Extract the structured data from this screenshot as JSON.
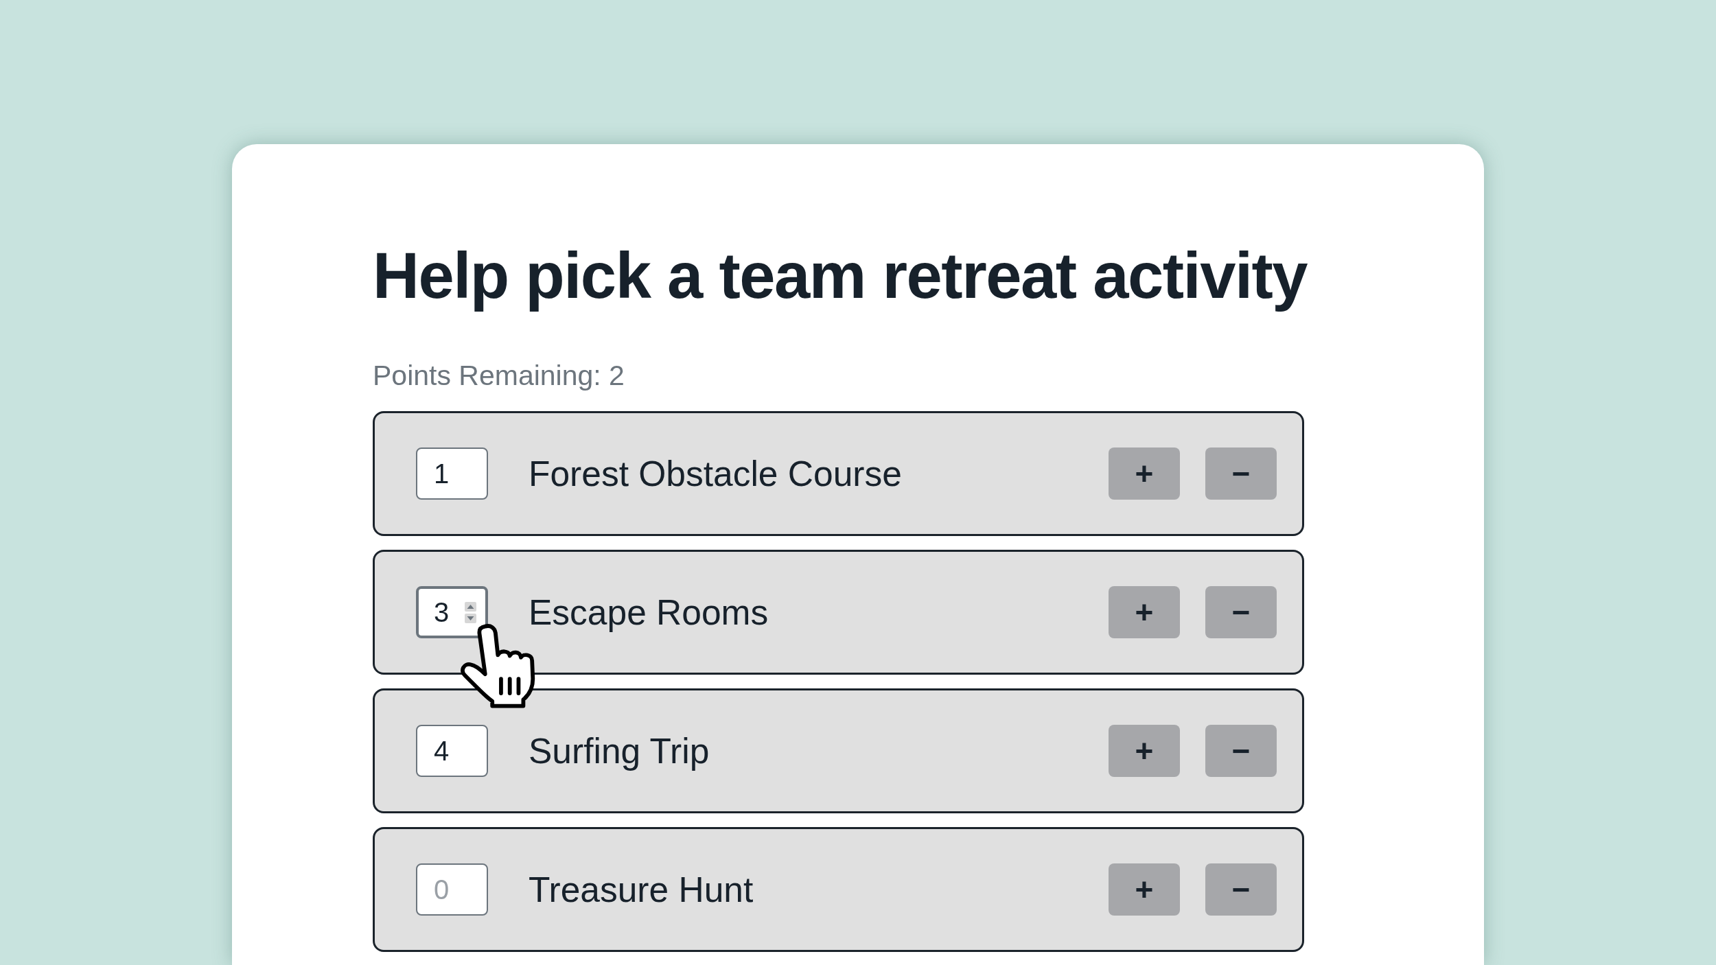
{
  "title": "Help pick a team retreat activity",
  "points_remaining": "Points Remaining: 2",
  "options": [
    {
      "value": "1",
      "label": "Forest Obstacle Course",
      "hovered": false,
      "increase_button": "+",
      "decrease_button": "−"
    },
    {
      "value": "3",
      "label": "Escape Rooms",
      "hovered": true,
      "increase_button": "+",
      "decrease_button": "−"
    },
    {
      "value": "4",
      "label": "Surfing Trip",
      "hovered": false,
      "increase_button": "+",
      "decrease_button": "−"
    },
    {
      "placeholder": "0",
      "label": "Treasure Hunt",
      "hovered": false,
      "increase_button": "+",
      "decrease_button": "−"
    }
  ]
}
